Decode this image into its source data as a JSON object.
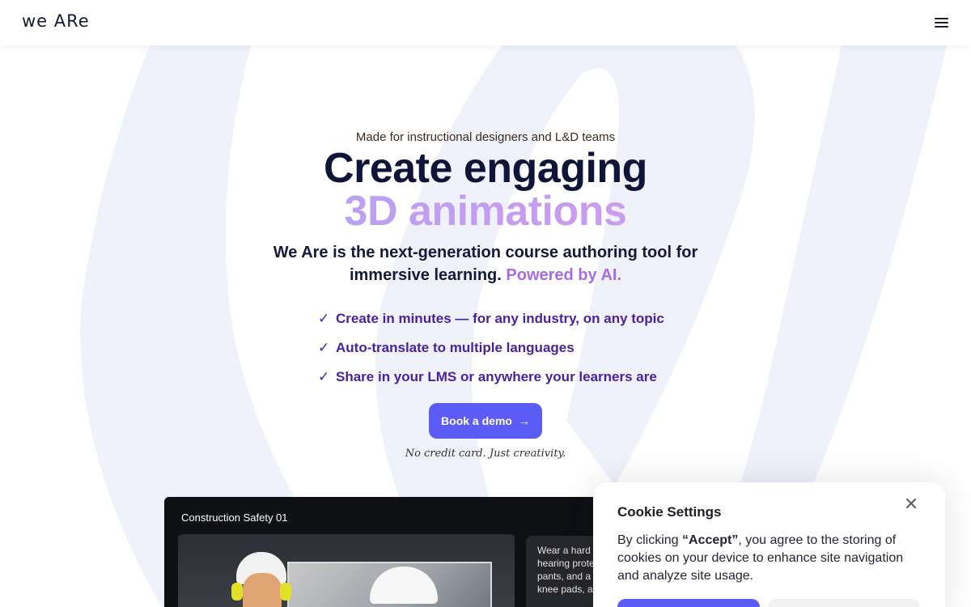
{
  "header": {
    "logo": "we ARe",
    "menu_icon": "hamburger-menu-icon"
  },
  "hero": {
    "eyebrow": "Made for instructional designers and L&D teams",
    "title_line1": "Create engaging",
    "title_line2": "3D animations",
    "lead_main": "We Are is the next-generation course authoring tool for immersive learning.",
    "lead_highlight": "Powered by AI.",
    "checks": [
      {
        "mark": "✓",
        "text": "Create in minutes — for any industry, on any topic"
      },
      {
        "mark": "✓",
        "text": "Auto-translate to multiple languages"
      },
      {
        "mark": "✓",
        "text": "Share in your LMS or anywhere your learners are"
      }
    ],
    "cta_label": "Book a demo",
    "cta_icon": "arrow-right-icon",
    "note": "No credit card. Just creativity."
  },
  "preview": {
    "title": "Construction Safety 01",
    "tip_text": "Wear a hard ha... hearing protec... pants, and a lo... knee pads, an..."
  },
  "cookie": {
    "title": "Cookie Settings",
    "close_icon": "close-icon",
    "body_prefix": "By clicking ",
    "body_bold": "“Accept”",
    "body_suffix": ", you agree to the storing of cookies on your device to enhance site navigation and analyze site usage."
  },
  "colors": {
    "accent": "#5b5bf7",
    "heading": "#0e1538",
    "gradient_start": "#a9a7f4",
    "gradient_end": "#d6a3ef",
    "check_text": "#4a1fa0",
    "background_shape": "#eff2fb"
  }
}
